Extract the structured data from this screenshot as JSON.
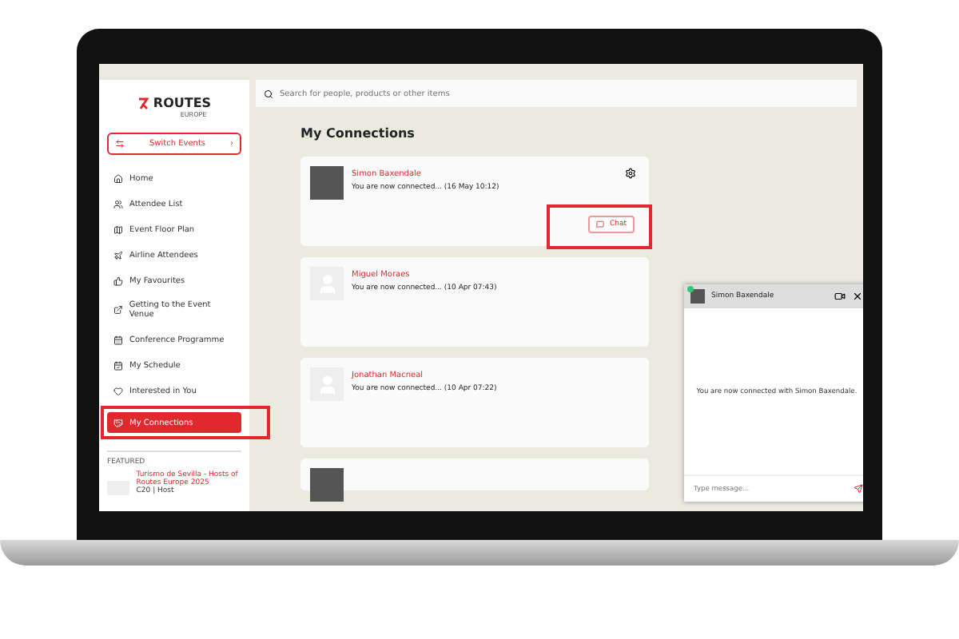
{
  "logo": {
    "name": "ROUTES",
    "region": "EUROPE"
  },
  "switch_button": {
    "label": "Switch Events",
    "arrow": "›"
  },
  "nav": [
    {
      "label": "Home",
      "selected": false,
      "highlighted": false
    },
    {
      "label": "Attendee List",
      "selected": false,
      "highlighted": false
    },
    {
      "label": "Event Floor Plan",
      "selected": false,
      "highlighted": false
    },
    {
      "label": "Airline Attendees",
      "selected": false,
      "highlighted": false
    },
    {
      "label": "My Favourites",
      "selected": false,
      "highlighted": false
    },
    {
      "label": "Getting to the Event Venue",
      "selected": false,
      "highlighted": false
    },
    {
      "label": "Conference Programme",
      "selected": false,
      "highlighted": false
    },
    {
      "label": "My Schedule",
      "selected": false,
      "highlighted": false
    },
    {
      "label": "Interested in You",
      "selected": false,
      "highlighted": false
    },
    {
      "label": "My Connections",
      "selected": true,
      "highlighted": true
    }
  ],
  "featured": {
    "heading": "FEATURED",
    "title": "Turismo de Sevilla - Hosts of Routes Europe 2025",
    "subtitle": "C20 | Host"
  },
  "search": {
    "placeholder": "Search for people, products or other items"
  },
  "page_title": "My Connections",
  "connections": [
    {
      "name": "Simon Baxendale",
      "message": "You are now connected...",
      "time": "(16 May 10:12)",
      "photo": true,
      "chat_button": "Chat",
      "chat_highlighted": true
    },
    {
      "name": "Miguel Moraes",
      "message": "You are now connected...",
      "time": "(10 Apr 07:43)",
      "photo": false
    },
    {
      "name": "Jonathan Macneal",
      "message": "You are now connected...",
      "time": "(10 Apr 07:22)",
      "photo": false
    },
    {
      "photo": true
    }
  ],
  "chat": {
    "name": "Simon Baxendale",
    "online": true,
    "message": "You are now connected with Simon Baxendale.",
    "placeholder": "Type message..."
  }
}
